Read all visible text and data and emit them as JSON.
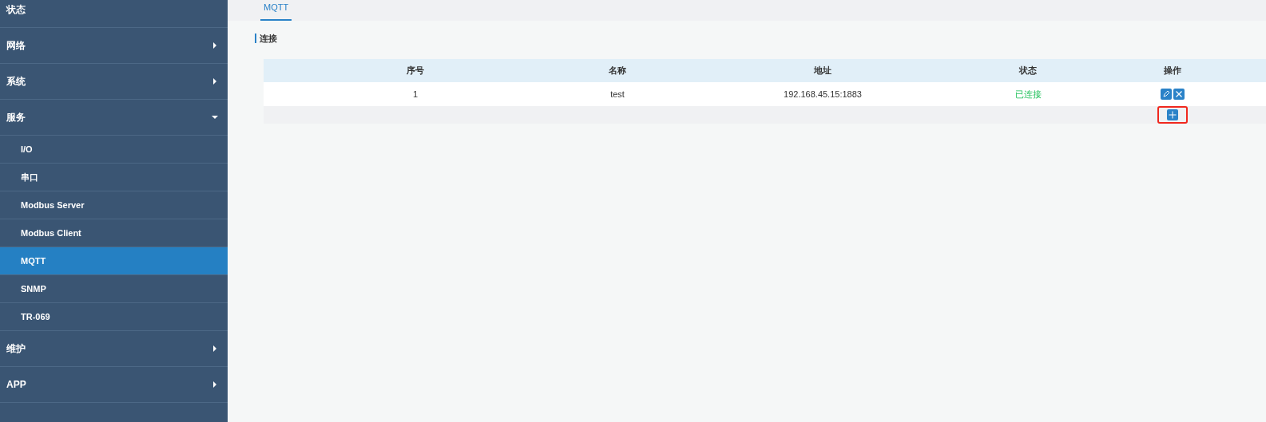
{
  "sidebar": {
    "items": [
      {
        "label": "状态",
        "has_arrow": false
      },
      {
        "label": "网络",
        "expanded": false,
        "has_arrow": true
      },
      {
        "label": "系统",
        "expanded": false,
        "has_arrow": true
      },
      {
        "label": "服务",
        "expanded": true,
        "has_arrow": true,
        "children": [
          {
            "label": "I/O",
            "selected": false
          },
          {
            "label": "串口",
            "selected": false
          },
          {
            "label": "Modbus Server",
            "selected": false
          },
          {
            "label": "Modbus Client",
            "selected": false
          },
          {
            "label": "MQTT",
            "selected": true
          },
          {
            "label": "SNMP",
            "selected": false
          },
          {
            "label": "TR-069",
            "selected": false
          }
        ]
      },
      {
        "label": "维护",
        "expanded": false,
        "has_arrow": true
      },
      {
        "label": "APP",
        "expanded": false,
        "has_arrow": true
      }
    ]
  },
  "tabs": [
    {
      "label": "MQTT",
      "selected": true
    }
  ],
  "section": {
    "title": "连接"
  },
  "table": {
    "columns": [
      "序号",
      "名称",
      "地址",
      "状态",
      "操作"
    ],
    "rows": [
      {
        "index": "1",
        "name": "test",
        "address": "192.168.45.15:1883",
        "status": "已连接",
        "connected": true
      }
    ],
    "add_button": {
      "highlighted": true
    }
  }
}
